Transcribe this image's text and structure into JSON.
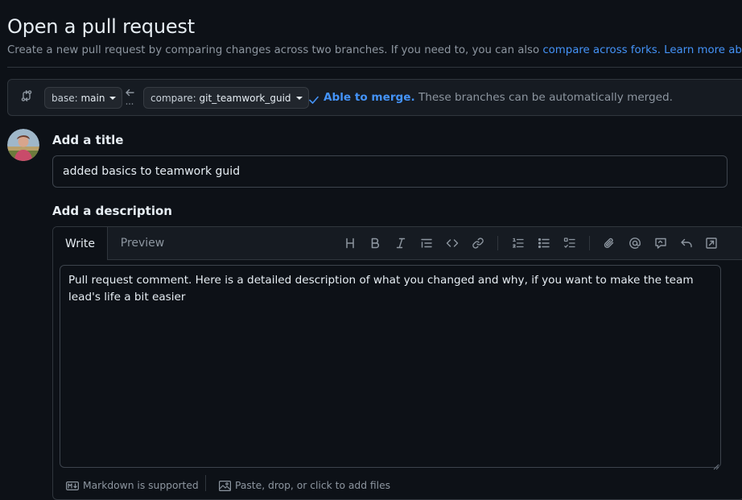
{
  "page": {
    "title": "Open a pull request",
    "subtitle_prefix": "Create a new pull request by comparing changes across two branches. If you need to, you can also ",
    "subtitle_link1": "compare across forks.",
    "subtitle_link2": "Learn more about"
  },
  "branches": {
    "base_label": "base:",
    "base_value": "main",
    "compare_label": "compare:",
    "compare_value": "git_teamwork_guid",
    "merge_ok": "Able to merge.",
    "merge_text": " These branches can be automatically merged."
  },
  "form": {
    "title_heading": "Add a title",
    "title_value": "added basics to teamwork guid",
    "desc_heading": "Add a description",
    "tabs": [
      "Write",
      "Preview"
    ],
    "desc_value": "Pull request comment. Here is a detailed description of what you changed and why, if you want to make the team lead's life a bit easier"
  },
  "toolbar": {
    "icons": [
      "heading-icon",
      "bold-icon",
      "italic-icon",
      "quote-icon",
      "code-icon",
      "link-icon",
      "numbered-list-icon",
      "unordered-list-icon",
      "task-list-icon",
      "attach-icon",
      "mention-icon",
      "reference-icon",
      "undo-icon",
      "fullscreen-icon"
    ]
  },
  "footer": {
    "markdown": "Markdown is supported",
    "attach": "Paste, drop, or click to add files"
  },
  "colors": {
    "bg": "#0d1117",
    "panel": "#161b22",
    "border": "#30363d",
    "accent": "#4493f8",
    "muted": "#8d96a0"
  }
}
